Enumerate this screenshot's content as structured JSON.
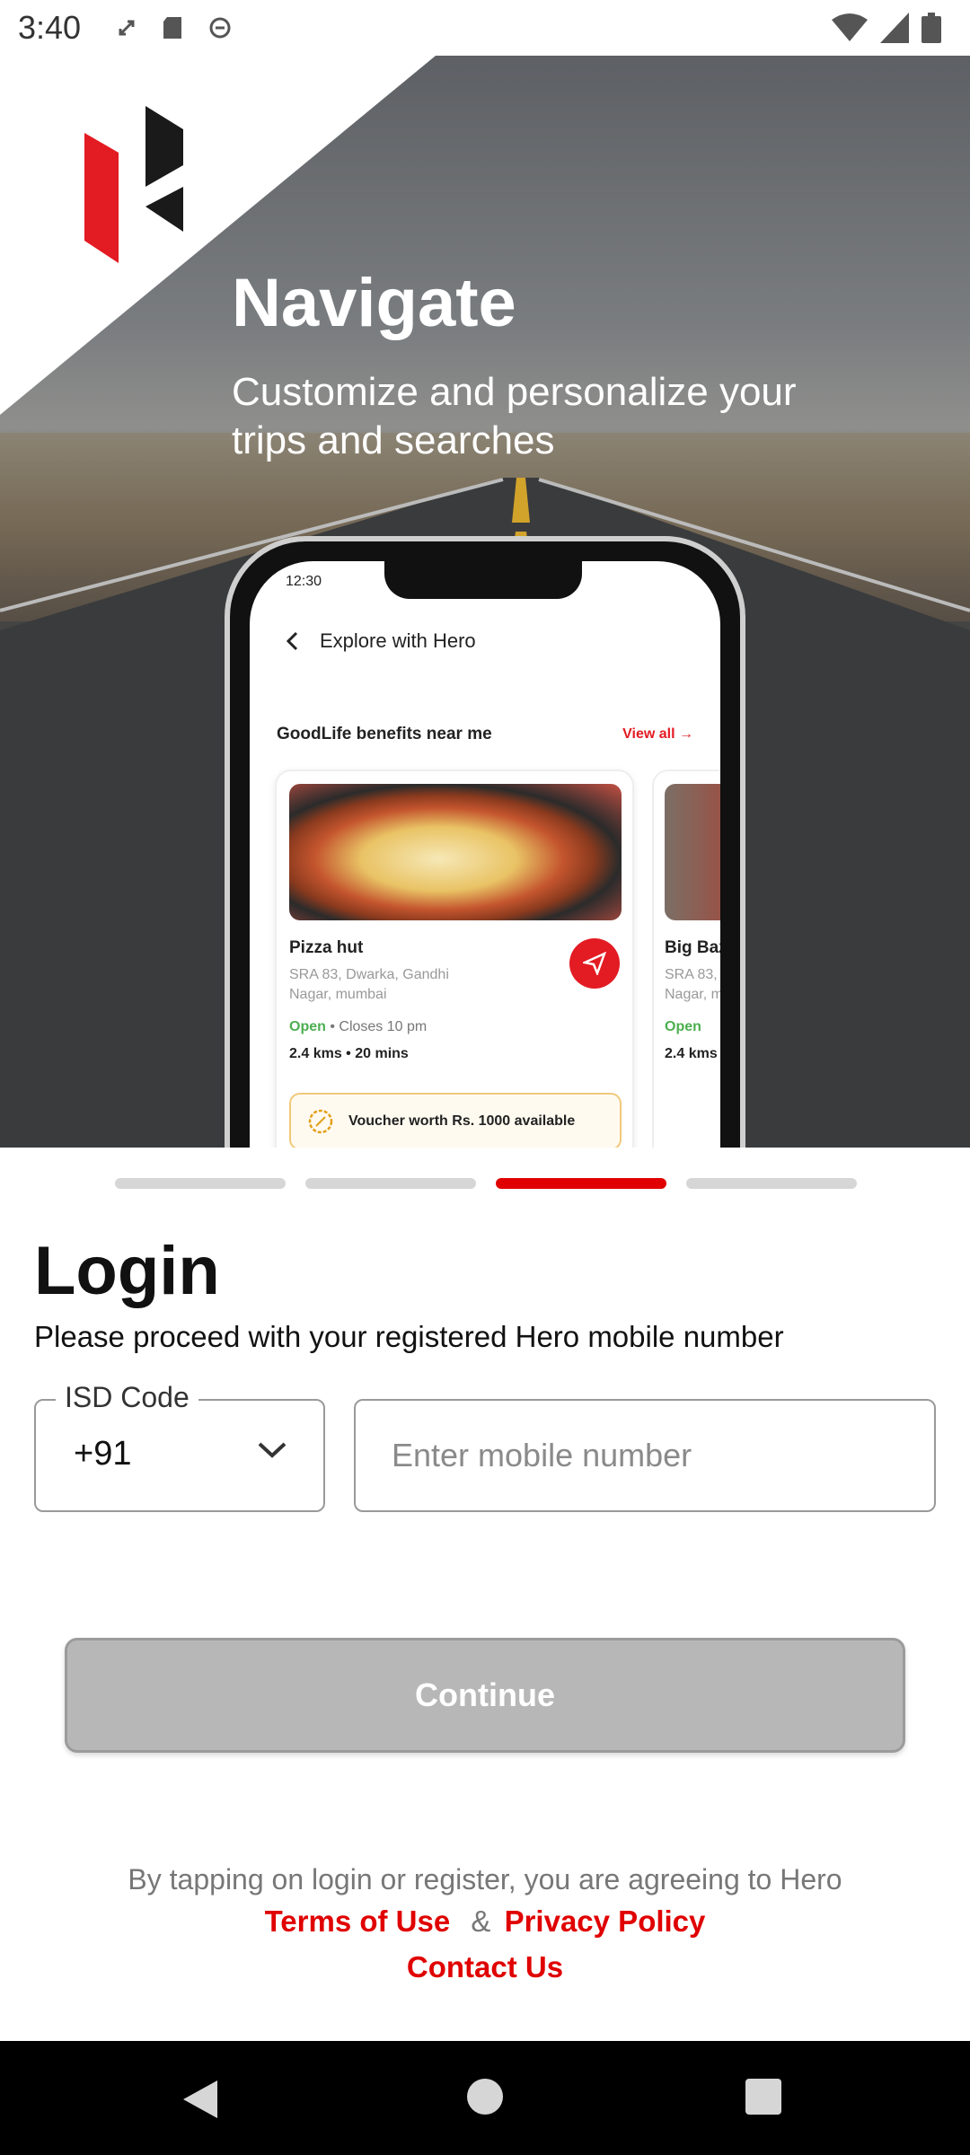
{
  "status_bar": {
    "time": "3:40",
    "left_icons": [
      "sync-icon",
      "sd-card-icon",
      "data-saver-icon"
    ],
    "right_icons": [
      "wifi-icon",
      "signal-icon",
      "battery-icon"
    ]
  },
  "hero": {
    "title": "Navigate",
    "subtitle": "Customize and personalize your trips and searches",
    "phone": {
      "time": "12:30",
      "header": "Explore with Hero",
      "section_title": "GoodLife benefits near me",
      "view_all": "View all",
      "card": {
        "title": "Pizza hut",
        "address": "SRA 83, Dwarka, Gandhi Nagar, mumbai",
        "open": "Open",
        "closes": "Closes 10 pm",
        "distance": "2.4 kms",
        "time": "20 mins",
        "voucher": "Voucher worth Rs. 1000 available"
      },
      "card2": {
        "title": "Big Baz",
        "address": "SRA 83,",
        "address2": "Nagar, m",
        "open": "Open",
        "distance": "2.4 kms"
      }
    }
  },
  "pager": {
    "count": 4,
    "active_index": 2
  },
  "login": {
    "title": "Login",
    "subtitle": "Please proceed with your registered Hero mobile number",
    "isd_label": "ISD Code",
    "isd_value": "+91",
    "mobile_placeholder": "Enter mobile number",
    "continue_label": "Continue"
  },
  "footer": {
    "terms_text": "By tapping on login or register, you are agreeing to Hero",
    "terms_link": "Terms of Use",
    "amp": "&",
    "privacy_link": "Privacy Policy",
    "contact_link": "Contact Us"
  },
  "colors": {
    "accent": "#e00000",
    "button_disabled": "#b7b7b7",
    "open_green": "#4caf50"
  }
}
